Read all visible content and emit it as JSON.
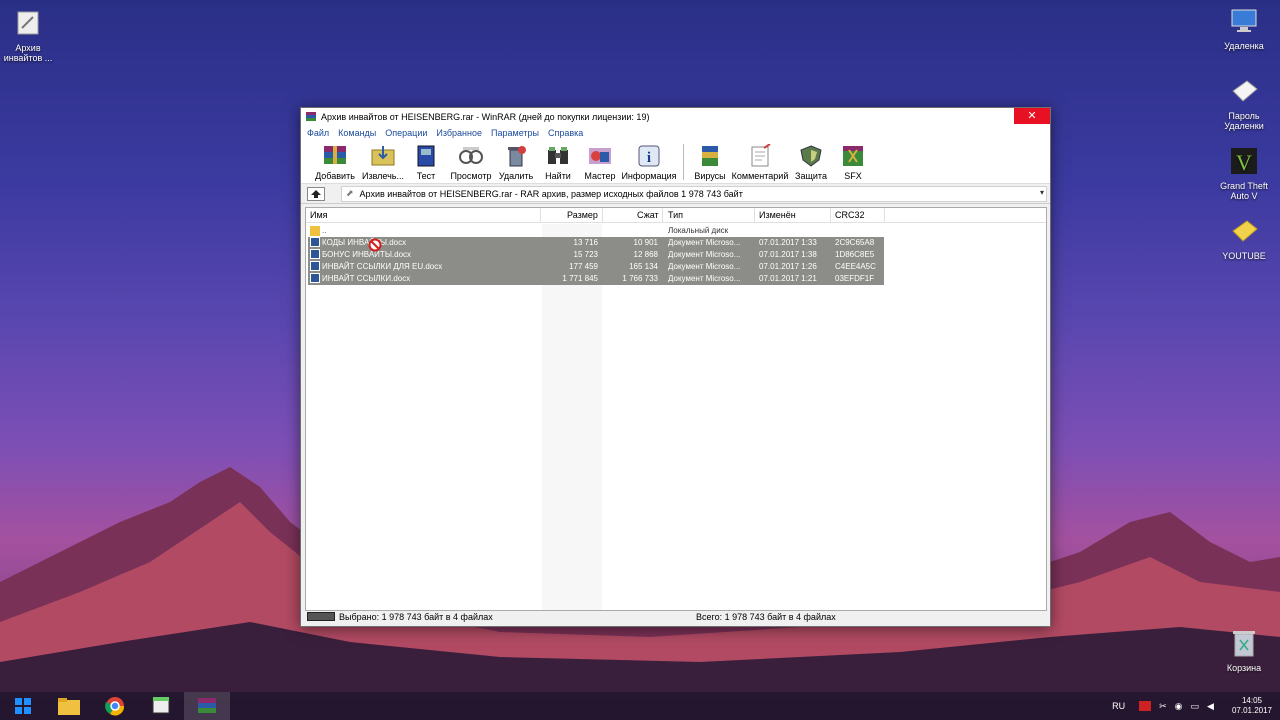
{
  "desktop": {
    "left_icons": [
      {
        "label": "Архив инвайтов ..."
      }
    ],
    "right_icons": [
      {
        "label": "Удаленка"
      },
      {
        "label": "Пароль Удаленки"
      },
      {
        "label": "Grand Theft Auto V"
      },
      {
        "label": "YOUTUBE"
      },
      {
        "label": "Корзина"
      }
    ]
  },
  "window": {
    "title": "Архив инвайтов от HEISENBERG.rar - WinRAR (дней до покупки лицензии: 19)",
    "close_glyph": "✕",
    "menu": [
      "Файл",
      "Команды",
      "Операции",
      "Избранное",
      "Параметры",
      "Справка"
    ],
    "toolbar": [
      {
        "label": "Добавить",
        "icon": "add-icon"
      },
      {
        "label": "Извлечь...",
        "icon": "extract-icon"
      },
      {
        "label": "Тест",
        "icon": "test-icon"
      },
      {
        "label": "Просмотр",
        "icon": "view-icon"
      },
      {
        "label": "Удалить",
        "icon": "delete-icon"
      },
      {
        "label": "Найти",
        "icon": "find-icon"
      },
      {
        "label": "Мастер",
        "icon": "wizard-icon"
      },
      {
        "label": "Информация",
        "icon": "info-icon"
      },
      {
        "label": "Вирусы",
        "icon": "virus-icon"
      },
      {
        "label": "Комментарий",
        "icon": "comment-icon"
      },
      {
        "label": "Защита",
        "icon": "protect-icon"
      },
      {
        "label": "SFX",
        "icon": "sfx-icon"
      }
    ],
    "address": "Архив инвайтов от HEISENBERG.rar - RAR архив, размер исходных файлов 1 978 743 байт",
    "columns": {
      "name": "Имя",
      "size": "Размер",
      "packed": "Сжат",
      "type": "Тип",
      "modified": "Изменён",
      "crc": "CRC32"
    },
    "parent_row": {
      "name": "..",
      "type": "Локальный диск"
    },
    "files": [
      {
        "name": "КОДЫ ИНВАЙТЫ.docx",
        "size": "13 716",
        "packed": "10 901",
        "type": "Документ Microso...",
        "modified": "07.01.2017 1:33",
        "crc": "2C9C65A8"
      },
      {
        "name": "БОНУС ИНВАЙТЫ.docx",
        "size": "15 723",
        "packed": "12 868",
        "type": "Документ Microso...",
        "modified": "07.01.2017 1:38",
        "crc": "1D86C8E5"
      },
      {
        "name": "ИНВАЙТ ССЫЛКИ ДЛЯ EU.docx",
        "size": "177 459",
        "packed": "165 134",
        "type": "Документ Microso...",
        "modified": "07.01.2017 1:26",
        "crc": "C4EE4A5C"
      },
      {
        "name": "ИНВАЙТ ССЫЛКИ.docx",
        "size": "1 771 845",
        "packed": "1 766 733",
        "type": "Документ Microso...",
        "modified": "07.01.2017 1:21",
        "crc": "03EFDF1F"
      }
    ],
    "status_left": "Выбрано: 1 978 743 байт в 4 файлах",
    "status_right": "Всего: 1 978 743 байт в 4 файлах"
  },
  "taskbar": {
    "lang": "RU",
    "time": "14:05",
    "date": "07.01.2017"
  }
}
